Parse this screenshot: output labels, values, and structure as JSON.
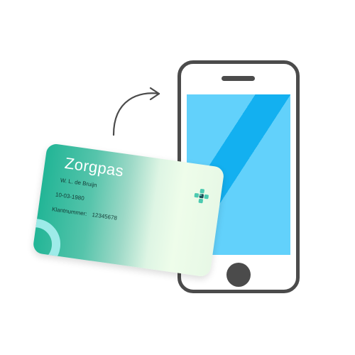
{
  "card": {
    "title": "Zorgpas",
    "name": "W. L. de Bruijn",
    "date": "10-03-1980",
    "customer_number_label": "Klantnummer:",
    "customer_number_value": "12345678"
  },
  "icons": {
    "arrow": "curved-arrow-icon",
    "logo": "plus-logo-icon",
    "phone": "phone-icon",
    "home_button": "home-button-icon",
    "speaker": "speaker-icon"
  },
  "colors": {
    "phone_frame": "#4b4b4b",
    "screen_light": "#62d1fb",
    "screen_dark": "#13b0f0",
    "card_teal": "#22b596",
    "card_light": "#eefdea",
    "text_dark": "#133c36",
    "corner_ring": "#a7efef"
  }
}
